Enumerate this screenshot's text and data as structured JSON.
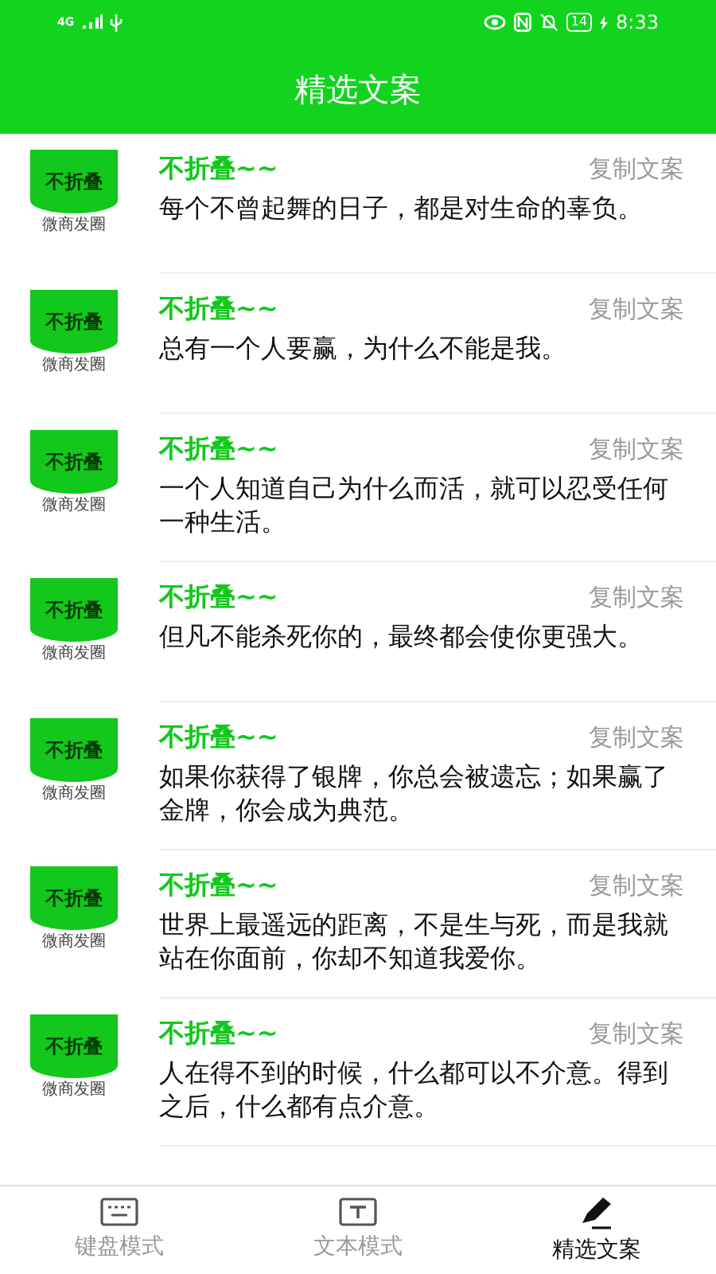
{
  "status_bar": {
    "network": "4G",
    "battery": "14",
    "time": "8:33"
  },
  "header": {
    "title": "精选文案"
  },
  "posts": [
    {
      "logo_name": "不折叠",
      "logo_tagline": "微商发圈",
      "author": "不折叠~~",
      "action": "复制文案",
      "text": "每个不曾起舞的日子，都是对生命的辜负。"
    },
    {
      "logo_name": "不折叠",
      "logo_tagline": "微商发圈",
      "author": "不折叠~~",
      "action": "复制文案",
      "text": "总有一个人要赢，为什么不能是我。"
    },
    {
      "logo_name": "不折叠",
      "logo_tagline": "微商发圈",
      "author": "不折叠~~",
      "action": "复制文案",
      "text": "一个人知道自己为什么而活，就可以忍受任何一种生活。"
    },
    {
      "logo_name": "不折叠",
      "logo_tagline": "微商发圈",
      "author": "不折叠~~",
      "action": "复制文案",
      "text": "但凡不能杀死你的，最终都会使你更强大。"
    },
    {
      "logo_name": "不折叠",
      "logo_tagline": "微商发圈",
      "author": "不折叠~~",
      "action": "复制文案",
      "text": "如果你获得了银牌，你总会被遗忘；如果赢了金牌，你会成为典范。"
    },
    {
      "logo_name": "不折叠",
      "logo_tagline": "微商发圈",
      "author": "不折叠~~",
      "action": "复制文案",
      "text": "世界上最遥远的距离，不是生与死，而是我就站在你面前，你却不知道我爱你。"
    },
    {
      "logo_name": "不折叠",
      "logo_tagline": "微商发圈",
      "author": "不折叠~~",
      "action": "复制文案",
      "text": "人在得不到的时候，什么都可以不介意。得到之后，什么都有点介意。"
    }
  ],
  "tabs": [
    {
      "kind": "keyboard",
      "label": "键盘模式",
      "selected": false
    },
    {
      "kind": "text",
      "label": "文本模式",
      "selected": false
    },
    {
      "kind": "pen",
      "label": "精选文案",
      "selected": true
    }
  ]
}
